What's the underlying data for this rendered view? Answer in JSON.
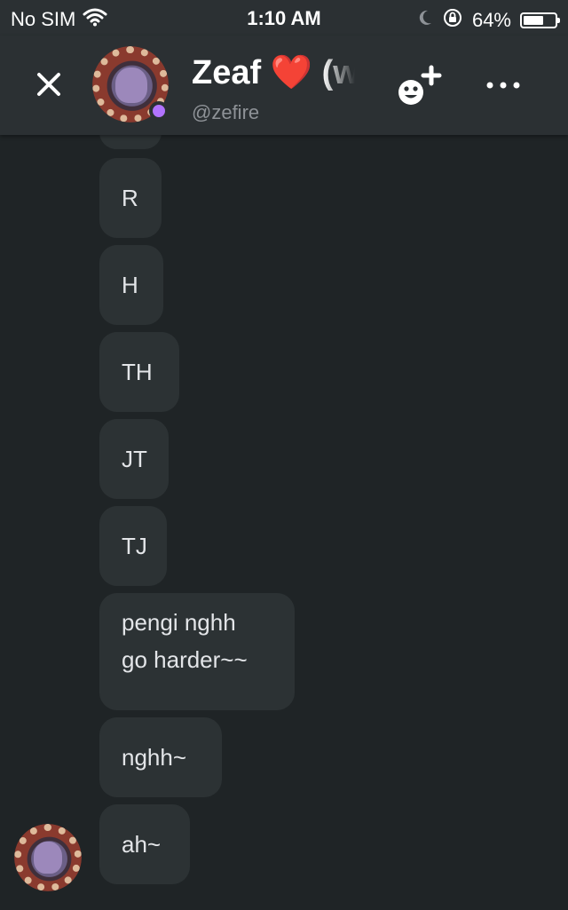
{
  "status_bar": {
    "carrier": "No SIM",
    "time": "1:10 AM",
    "battery_percent": "64%",
    "battery_level": 0.64,
    "icons": [
      "wifi-icon",
      "moon-icon",
      "orientation-lock-icon",
      "battery-icon"
    ]
  },
  "header": {
    "display_name": "Zeaf ❤️ (w",
    "username": "@zefire",
    "presence_color": "#b173ff",
    "buttons": [
      "close-icon",
      "add-friend-icon",
      "more-icon"
    ]
  },
  "messages": [
    {
      "text": ""
    },
    {
      "text": "R"
    },
    {
      "text": "H"
    },
    {
      "text": "TH"
    },
    {
      "text": "JT"
    },
    {
      "text": "TJ"
    },
    {
      "text": "pengi nghh go harder~~",
      "lines": [
        "pengi nghh",
        "go harder~~"
      ]
    },
    {
      "text": "nghh~"
    },
    {
      "text": "ah~"
    }
  ],
  "colors": {
    "background": "#1f2426",
    "header": "#2b3033",
    "bubble": "#2c3234"
  }
}
